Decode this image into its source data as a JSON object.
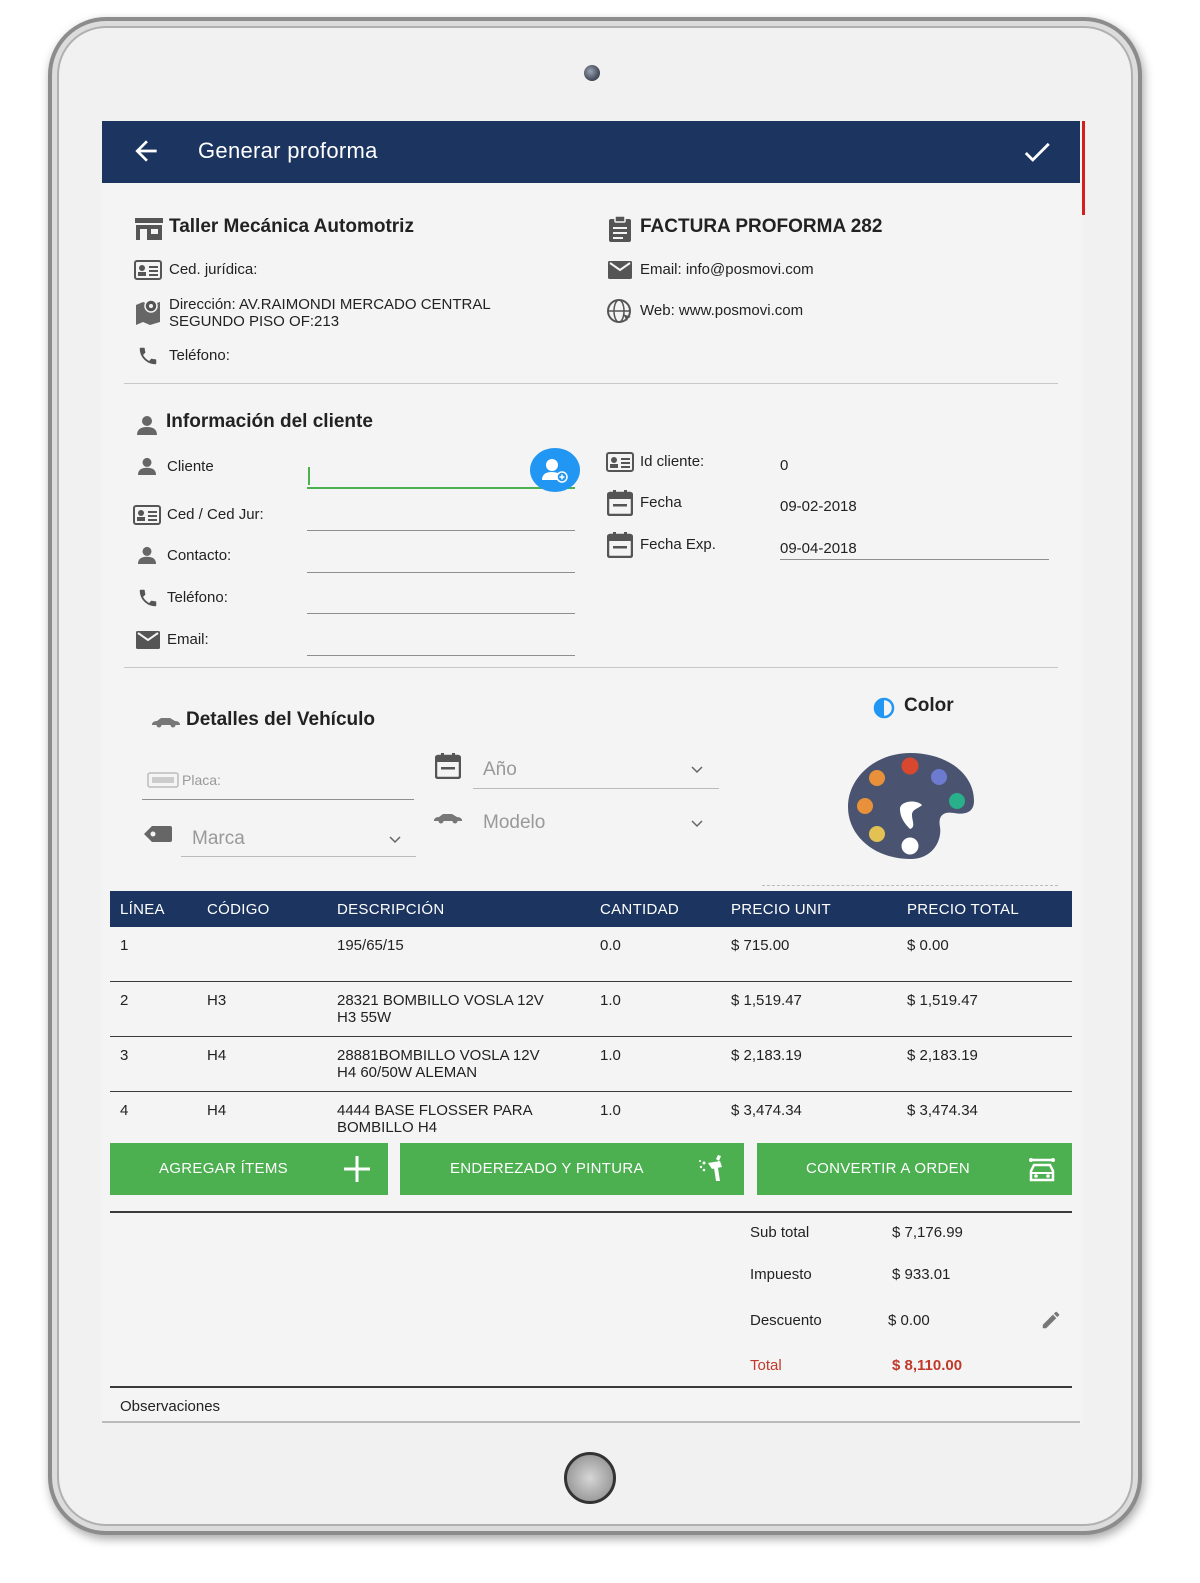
{
  "app": {
    "title": "Generar proforma"
  },
  "company": {
    "name": "Taller Mecánica Automotriz",
    "ced_label": "Ced. jurídica:",
    "address_line1": "Dirección: AV.RAIMONDI MERCADO CENTRAL",
    "address_line2": "SEGUNDO PISO OF:213",
    "phone_label": "Teléfono:"
  },
  "invoice": {
    "title": "FACTURA PROFORMA 282",
    "email": "Email: info@posmovi.com",
    "web": "Web: www.posmovi.com"
  },
  "client": {
    "section_title": "Información del cliente",
    "cliente_label": "Cliente",
    "ced_label": "Ced / Ced Jur:",
    "contacto_label": "Contacto:",
    "telefono_label": "Teléfono:",
    "email_label": "Email:",
    "id_label": "Id cliente:",
    "id_value": "0",
    "fecha_label": "Fecha",
    "fecha_value": "09-02-2018",
    "fecha_exp_label": "Fecha Exp.",
    "fecha_exp_value": "09-04-2018"
  },
  "vehicle": {
    "section_title": "Detalles del Vehículo",
    "placa_placeholder": "Placa:",
    "anio_placeholder": "Año",
    "marca_placeholder": "Marca",
    "modelo_placeholder": "Modelo",
    "color_title": "Color"
  },
  "table": {
    "headers": [
      "LÍNEA",
      "CÓDIGO",
      "DESCRIPCIÓN",
      "CANTIDAD",
      "PRECIO UNIT",
      "PRECIO TOTAL"
    ],
    "rows": [
      {
        "linea": "1",
        "codigo": "",
        "desc1": "195/65/15",
        "desc2": "",
        "cantidad": "0.0",
        "unit": "$ 715.00",
        "total": "$ 0.00"
      },
      {
        "linea": "2",
        "codigo": "H3",
        "desc1": "28321 BOMBILLO VOSLA 12V",
        "desc2": "H3 55W",
        "cantidad": "1.0",
        "unit": "$ 1,519.47",
        "total": "$ 1,519.47"
      },
      {
        "linea": "3",
        "codigo": "H4",
        "desc1": "28881BOMBILLO VOSLA 12V",
        "desc2": "H4 60/50W ALEMAN",
        "cantidad": "1.0",
        "unit": "$ 2,183.19",
        "total": "$ 2,183.19"
      },
      {
        "linea": "4",
        "codigo": "H4",
        "desc1": "4444 BASE FLOSSER PARA",
        "desc2": "BOMBILLO H4",
        "cantidad": "1.0",
        "unit": "$ 3,474.34",
        "total": "$ 3,474.34"
      }
    ]
  },
  "actions": {
    "agregar": "AGREGAR ÍTEMS",
    "enderezado": "ENDEREZADO Y PINTURA",
    "convertir": "CONVERTIR A ORDEN"
  },
  "totals": {
    "subtotal_label": "Sub total",
    "subtotal_value": "$ 7,176.99",
    "impuesto_label": "Impuesto",
    "impuesto_value": "$ 933.01",
    "descuento_label": "Descuento",
    "descuento_value": "$ 0.00",
    "total_label": "Total",
    "total_value": "$ 8,110.00"
  },
  "observaciones_label": "Observaciones",
  "colors": {
    "primary": "#1c3560",
    "action_green": "#4caf50",
    "total_red": "#c0392b",
    "accent_blue": "#2196f3"
  }
}
